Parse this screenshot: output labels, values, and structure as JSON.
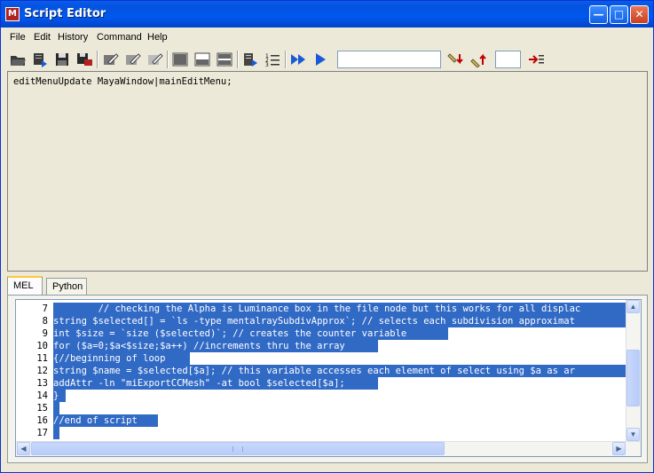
{
  "window": {
    "title": "Script Editor",
    "icon": "maya-icon",
    "controls": [
      "minimize",
      "maximize",
      "close"
    ]
  },
  "menu": {
    "items": [
      "File",
      "Edit",
      "History",
      "Command",
      "Help"
    ]
  },
  "toolbar": {
    "icons": [
      "open-script-icon",
      "source-script-icon",
      "save-script-icon",
      "save-to-shelf-icon",
      "clear-history-icon",
      "clear-input-icon",
      "clear-all-icon",
      "show-history-only-icon",
      "show-input-only-icon",
      "show-both-icon",
      "echo-commands-icon",
      "show-line-numbers-icon",
      "execute-all-icon",
      "execute-icon",
      "search-down-icon",
      "search-up-icon",
      "goto-line-icon"
    ],
    "search_value": "",
    "line_value": ""
  },
  "history": {
    "text": "editMenuUpdate MayaWindow|mainEditMenu;"
  },
  "tabs": [
    {
      "label": "MEL",
      "active": true
    },
    {
      "label": "Python",
      "active": false
    }
  ],
  "editor": {
    "lines": [
      {
        "num": "7",
        "text": "        // checking the Alpha is Luminance box in the file node but this works for all displac"
      },
      {
        "num": "8",
        "text": "string $selected[] = `ls -type mentalraySubdivApprox`; // selects each subdivision approximat"
      },
      {
        "num": "9",
        "text": "int $size = `size ($selected)`; // creates the counter variable "
      },
      {
        "num": "10",
        "text": "for ($a=0;$a<$size;$a++) //increments thru the array "
      },
      {
        "num": "11",
        "text": "{//beginning of loop "
      },
      {
        "num": "12",
        "text": "string $name = $selected[$a]; // this variable accesses each element of select using $a as ar"
      },
      {
        "num": "13",
        "text": "addAttr -ln \"miExportCCMesh\" -at bool $selected[$a];"
      },
      {
        "num": "14",
        "text": "}"
      },
      {
        "num": "15",
        "text": " "
      },
      {
        "num": "16",
        "text": "//end of script "
      },
      {
        "num": "17",
        "text": " "
      }
    ],
    "selection_color": "#316AC5"
  },
  "colors": {
    "titlebar": "#0058EE",
    "panel": "#ECE9D8",
    "selection": "#316AC5"
  }
}
